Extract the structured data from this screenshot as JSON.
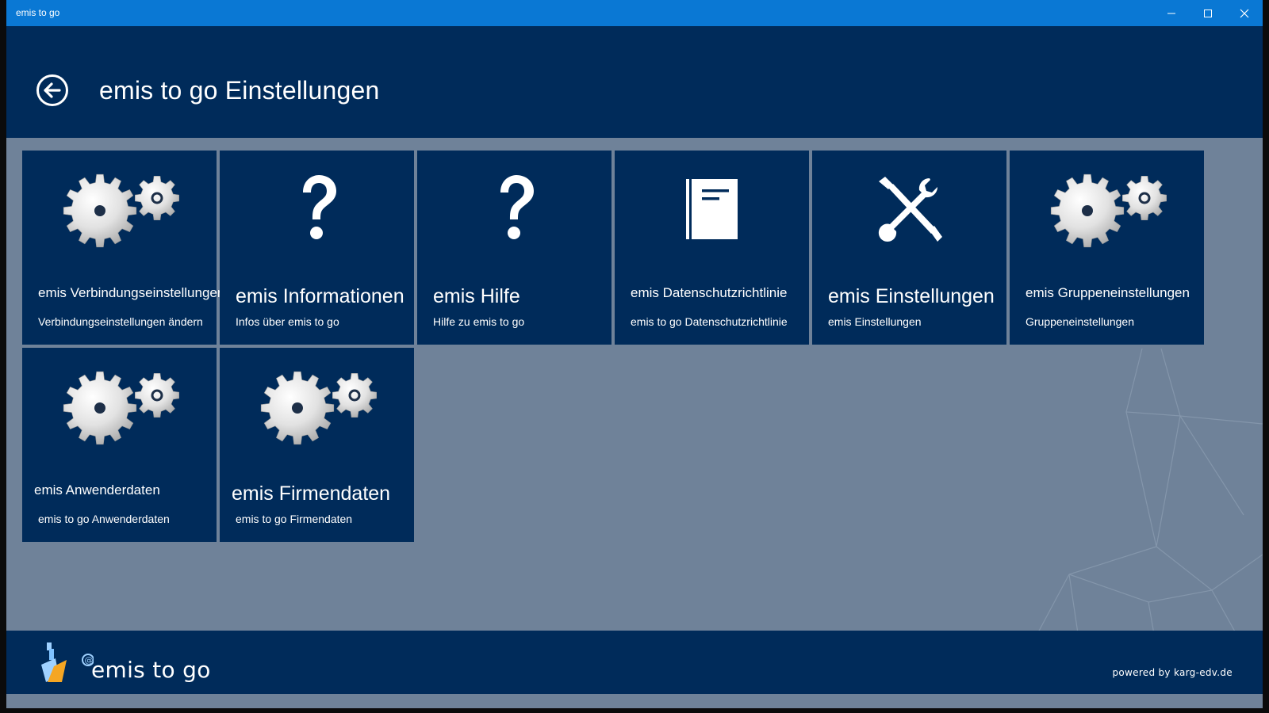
{
  "window": {
    "title": "emis to go",
    "controls": {
      "minimize": "minimize",
      "maximize": "maximize",
      "close": "close"
    }
  },
  "header": {
    "title": "emis to go Einstellungen"
  },
  "tiles": [
    {
      "title": "emis Verbindungseinstellungen",
      "subtitle": "Verbindungseinstellungen ändern",
      "icon": "gears-icon"
    },
    {
      "title": "emis Informationen",
      "subtitle": "Infos über emis to go",
      "icon": "question-icon"
    },
    {
      "title": "emis Hilfe",
      "subtitle": "Hilfe zu emis to go",
      "icon": "question-icon"
    },
    {
      "title": "emis Datenschutzrichtlinie",
      "subtitle": "emis to go Datenschutzrichtlinie",
      "icon": "book-icon"
    },
    {
      "title": "emis Einstellungen",
      "subtitle": "emis Einstellungen",
      "icon": "tools-icon"
    },
    {
      "title": "emis Gruppeneinstellungen",
      "subtitle": "Gruppeneinstellungen",
      "icon": "gears-icon"
    },
    {
      "title": "emis Anwenderdaten",
      "subtitle": "emis to go Anwenderdaten",
      "icon": "gears-icon"
    },
    {
      "title": "emis Firmendaten",
      "subtitle": "emis to go Firmendaten",
      "icon": "gears-icon"
    }
  ],
  "footer": {
    "logo_text": "emis to go",
    "powered_by": "powered by karg-edv.de"
  },
  "colors": {
    "titlebar": "#0a78d4",
    "header": "#002b5a",
    "tile": "#002b5a",
    "background": "#6f8299"
  }
}
